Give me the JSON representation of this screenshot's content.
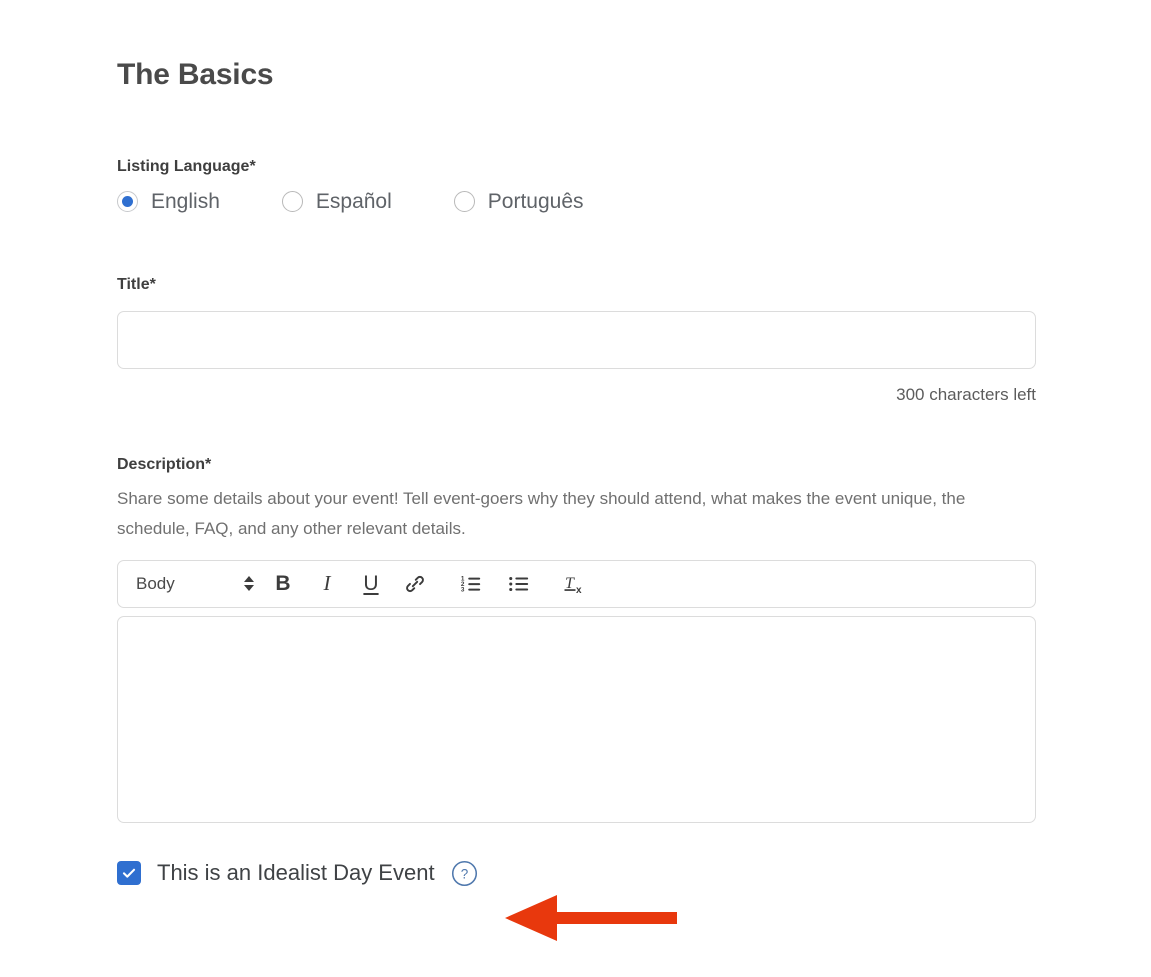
{
  "page": {
    "section_title": "The Basics"
  },
  "listing_language": {
    "label": "Listing Language*",
    "options": [
      {
        "label": "English",
        "selected": true
      },
      {
        "label": "Español",
        "selected": false
      },
      {
        "label": "Português",
        "selected": false
      }
    ]
  },
  "title_field": {
    "label": "Title*",
    "value": "",
    "placeholder": "",
    "char_counter": "300 characters left"
  },
  "description_field": {
    "label": "Description*",
    "help_text": "Share some details about your event! Tell event-goers why they should attend, what makes the event unique, the schedule, FAQ, and any other relevant details.",
    "value": "",
    "placeholder": "",
    "toolbar": {
      "style_select_value": "Body",
      "style_select_icon": "up-down-chevron-icon",
      "buttons": [
        {
          "name": "bold-button",
          "glyph": "B",
          "icon": "bold-icon"
        },
        {
          "name": "italic-button",
          "glyph": "I",
          "icon": "italic-icon"
        },
        {
          "name": "underline-button",
          "glyph": "U",
          "icon": "underline-icon"
        },
        {
          "name": "link-button",
          "glyph": "",
          "icon": "link-icon"
        },
        {
          "name": "numbered-list-button",
          "glyph": "",
          "icon": "numbered-list-icon"
        },
        {
          "name": "bulleted-list-button",
          "glyph": "",
          "icon": "bulleted-list-icon"
        },
        {
          "name": "clear-formatting-button",
          "glyph": "",
          "icon": "clear-formatting-icon"
        }
      ]
    }
  },
  "idealist_day_checkbox": {
    "label": "This is an Idealist Day Event",
    "checked": true,
    "help_icon": "question-mark-circle-icon"
  },
  "annotation": {
    "type": "arrow",
    "direction": "left",
    "color": "#e8380d"
  },
  "colors": {
    "accent_blue": "#2f6fd0",
    "help_blue": "#4f78ad",
    "border_gray": "#dcdcdc",
    "text_dark": "#3f3f3f",
    "text_muted": "#707070",
    "annotation_red": "#e8380d"
  }
}
